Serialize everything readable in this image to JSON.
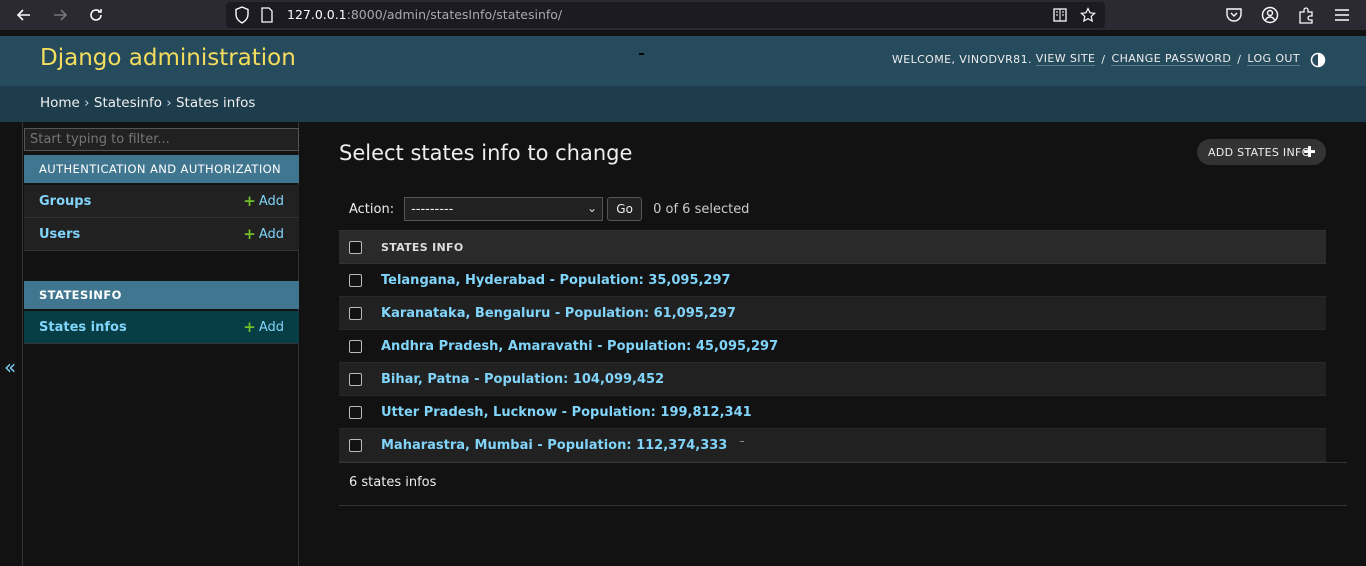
{
  "browser": {
    "url_host": "127.0.0.1",
    "url_rest": ":8000/admin/statesInfo/statesinfo/"
  },
  "header": {
    "brand": "Django administration",
    "welcome": "WELCOME, VINODVR81.",
    "view_site": "VIEW SITE",
    "change_password": "CHANGE PASSWORD",
    "log_out": "LOG OUT",
    "sep": "/"
  },
  "breadcrumbs": {
    "home": "Home",
    "app": "Statesinfo",
    "model": "States infos",
    "separator": "›"
  },
  "sidebar": {
    "filter_placeholder": "Start typing to filter...",
    "modules": [
      {
        "caption": "AUTHENTICATION AND AUTHORIZATION",
        "models": [
          {
            "name": "Groups",
            "add": "Add"
          },
          {
            "name": "Users",
            "add": "Add"
          }
        ]
      },
      {
        "caption": "STATESINFO",
        "models": [
          {
            "name": "States infos",
            "add": "Add"
          }
        ]
      }
    ],
    "collapse_glyph": "«"
  },
  "main": {
    "title": "Select states info to change",
    "add_button": "ADD STATES INFO",
    "action_label": "Action:",
    "action_value": "---------",
    "go_label": "Go",
    "selected_text": "0 of 6 selected",
    "column_header": "STATES INFO",
    "rows": [
      "Telangana, Hyderabad - Population: 35,095,297",
      "Karanataka, Bengaluru - Population: 61,095,297",
      "Andhra Pradesh, Amaravathi - Population: 45,095,297",
      "Bihar, Patna - Population: 104,099,452",
      "Utter Pradesh, Lucknow - Population: 199,812,341",
      "Maharastra, Mumbai - Population: 112,374,333"
    ],
    "paginator": "6 states infos"
  },
  "colors": {
    "header_bg": "#264b5d",
    "brand": "#f5dd5d",
    "breadcrumb_bg": "#1d3d4c",
    "module_caption": "#417690",
    "link": "#81d4fa",
    "add_green": "#70bf2b"
  }
}
